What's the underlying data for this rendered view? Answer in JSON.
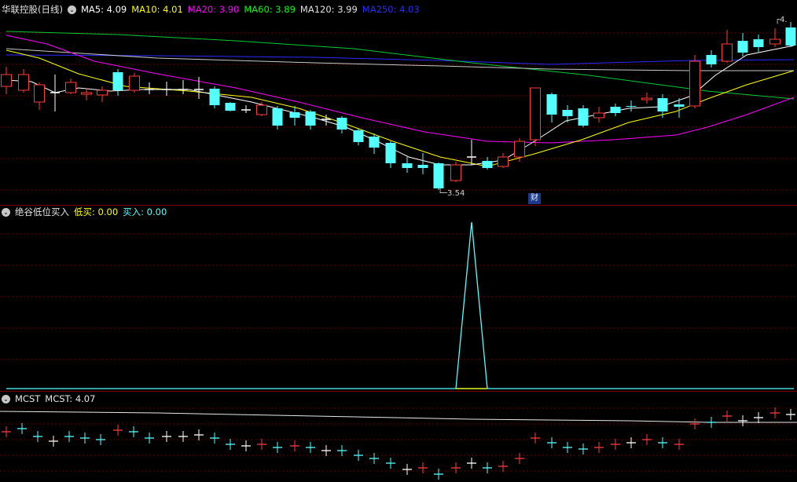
{
  "main": {
    "stock_name": "华联控股(日线)",
    "ma": [
      {
        "label": "MA5: 4.09",
        "color": "#ffffff"
      },
      {
        "label": "MA10: 4.01",
        "color": "#ffff00"
      },
      {
        "label": "MA20: 3.90",
        "color": "#ff00ff"
      },
      {
        "label": "MA60: 3.89",
        "color": "#00ff00"
      },
      {
        "label": "MA120: 3.99",
        "color": "#e0e0e0"
      },
      {
        "label": "MA250: 4.03",
        "color": "#0000ff"
      }
    ],
    "low_label": "3.54",
    "high_label": "4.",
    "cai_badge": "财"
  },
  "indicator": {
    "title": "绝谷低位买入",
    "low_buy": "低买: 0.00",
    "buy": "买入: 0.00"
  },
  "mcst": {
    "name": "MCST",
    "value": "MCST: 4.07"
  },
  "colors": {
    "up": "#ff3b3b",
    "down": "#54ffff",
    "separator": "#7a0000",
    "grid": "#6b0000"
  }
}
